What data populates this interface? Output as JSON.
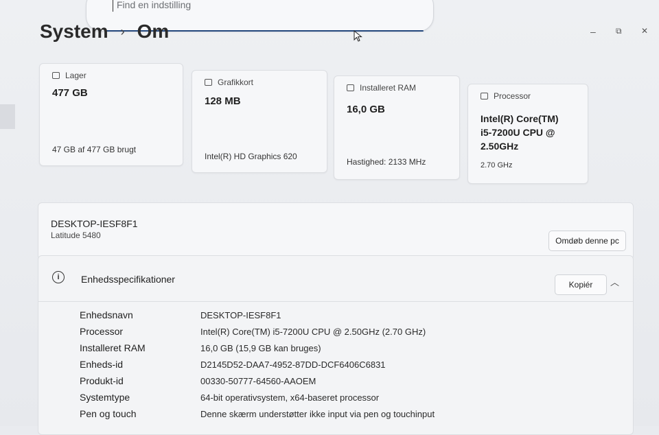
{
  "search": {
    "placeholder": "Find en indstilling"
  },
  "window_controls": {
    "minimize": "–",
    "maximize": "⧉",
    "close": "✕"
  },
  "breadcrumb": {
    "parent": "System",
    "separator": "›",
    "current": "Om"
  },
  "cards": {
    "storage": {
      "title": "Lager",
      "value": "477 GB",
      "sub": "47 GB af 477 GB brugt"
    },
    "graphics": {
      "title": "Grafikkort",
      "value": "128 MB",
      "sub": "Intel(R) HD Graphics 620"
    },
    "ram": {
      "title": "Installeret RAM",
      "value": "16,0 GB",
      "sub": "Hastighed: 2133 MHz"
    },
    "processor": {
      "title": "Processor",
      "value": "Intel(R) Core(TM) i5-7200U CPU @ 2.50GHz",
      "sub": "2.70 GHz"
    }
  },
  "device": {
    "name": "DESKTOP-IESF8F1",
    "model": "Latitude 5480",
    "rename_label": "Omdøb denne pc"
  },
  "specs": {
    "title": "Enhedsspecifikationer",
    "copy_label": "Kopiér",
    "rows": [
      {
        "key": "Enhedsnavn",
        "value": "DESKTOP-IESF8F1"
      },
      {
        "key": "Processor",
        "value": "Intel(R) Core(TM) i5-7200U CPU @ 2.50GHz (2.70 GHz)"
      },
      {
        "key": "Installeret RAM",
        "value": "16,0 GB (15,9 GB kan bruges)"
      },
      {
        "key": "Enheds-id",
        "value": "D2145D52-DAA7-4952-87DD-DCF6406C6831"
      },
      {
        "key": "Produkt-id",
        "value": "00330-50777-64560-AAOEM"
      },
      {
        "key": "Systemtype",
        "value": "64-bit operativsystem, x64-baseret processor"
      },
      {
        "key": "Pen og touch",
        "value": "Denne skærm understøtter ikke input via pen og touchinput"
      }
    ]
  }
}
